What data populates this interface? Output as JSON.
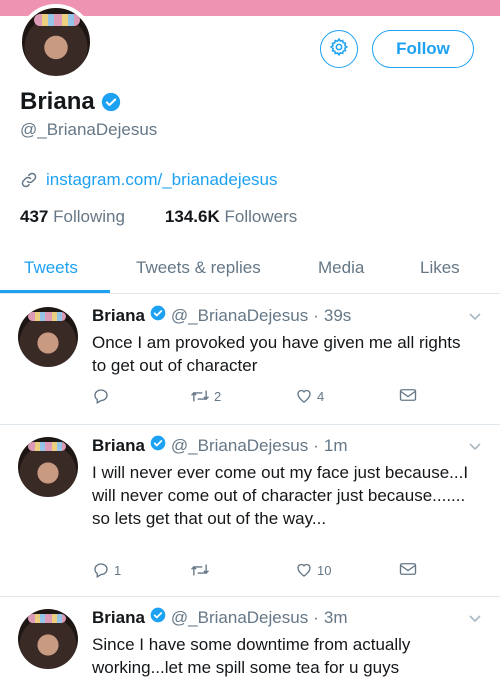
{
  "colors": {
    "accent": "#1da1f2",
    "banner": "#ef93b3",
    "secondary_text": "#657786"
  },
  "profile": {
    "name": "Briana",
    "handle": "@_BrianaDejesus",
    "link": "instagram.com/_brianadejesus",
    "following_count": "437",
    "following_label": "Following",
    "followers_count": "134.6K",
    "followers_label": "Followers",
    "follow_label": "Follow"
  },
  "tabs": [
    {
      "label": "Tweets",
      "active": true
    },
    {
      "label": "Tweets & replies",
      "active": false
    },
    {
      "label": "Media",
      "active": false
    },
    {
      "label": "Likes",
      "active": false
    }
  ],
  "tweets": [
    {
      "name": "Briana",
      "handle": "@_BrianaDejesus",
      "separator": "·",
      "time": "39s",
      "text": "Once I am provoked you have given me all rights to get out of character",
      "reply_count": "",
      "retweet_count": "2",
      "like_count": "4"
    },
    {
      "name": "Briana",
      "handle": "@_BrianaDejesus",
      "separator": "·",
      "time": "1m",
      "text": "I will never ever come out my face just because...I will never come out of character just because....... so lets get that out of the way...",
      "reply_count": "1",
      "retweet_count": "",
      "like_count": "10"
    },
    {
      "name": "Briana",
      "handle": "@_BrianaDejesus",
      "separator": "·",
      "time": "3m",
      "text": "Since I have some downtime from actually working...let me spill some tea for u guys",
      "reply_count": "",
      "retweet_count": "",
      "like_count": ""
    }
  ]
}
